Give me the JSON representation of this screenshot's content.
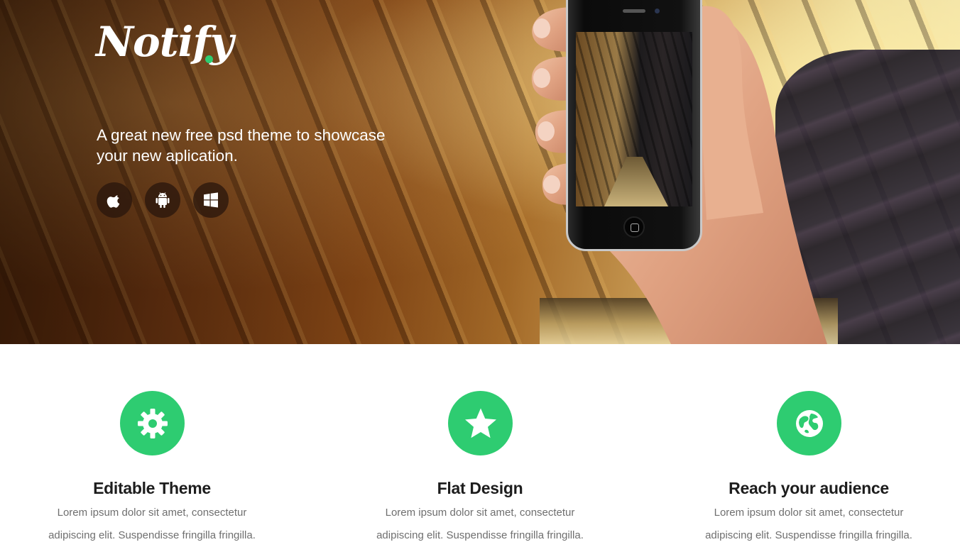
{
  "brand": {
    "logo_text": "Notify",
    "accent_color": "#2ecc71"
  },
  "hero": {
    "tagline_line1": "A great new free psd theme to showcase",
    "tagline_line2": "your new aplication.",
    "platforms": [
      {
        "name": "Apple",
        "icon": "apple-icon"
      },
      {
        "name": "Android",
        "icon": "android-icon"
      },
      {
        "name": "Windows",
        "icon": "windows-icon"
      }
    ]
  },
  "features": [
    {
      "icon": "gear-icon",
      "title": "Editable Theme",
      "text_line1": "Lorem ipsum dolor sit amet, consectetur",
      "text_line2": "adipiscing elit. Suspendisse fringilla fringilla."
    },
    {
      "icon": "star-icon",
      "title": "Flat Design",
      "text_line1": "Lorem ipsum dolor sit amet, consectetur",
      "text_line2": "adipiscing elit. Suspendisse fringilla fringilla."
    },
    {
      "icon": "globe-icon",
      "title": "Reach your audience",
      "text_line1": "Lorem ipsum dolor sit amet, consectetur",
      "text_line2": "adipiscing elit. Suspendisse fringilla fringilla."
    }
  ]
}
